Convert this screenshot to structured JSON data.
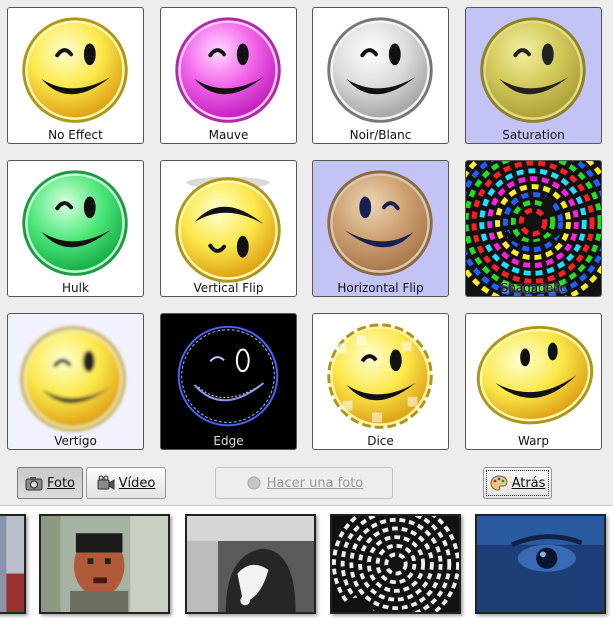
{
  "effects": [
    {
      "label": "No Effect"
    },
    {
      "label": "Mauve"
    },
    {
      "label": "Noir/Blanc"
    },
    {
      "label": "Saturation"
    },
    {
      "label": "Hulk"
    },
    {
      "label": "Vertical Flip"
    },
    {
      "label": "Horizontal Flip"
    },
    {
      "label": "Shagadelic"
    },
    {
      "label": "Vertigo"
    },
    {
      "label": "Edge"
    },
    {
      "label": "Dice"
    },
    {
      "label": "Warp"
    }
  ],
  "toolbar": {
    "foto_label": "Foto",
    "video_label": "Vídeo",
    "take_photo_label": "Hacer una foto",
    "back_label": "Atrás"
  },
  "colors": {
    "selected_bg": "#c3c3f5",
    "window_bg": "#ededed"
  }
}
